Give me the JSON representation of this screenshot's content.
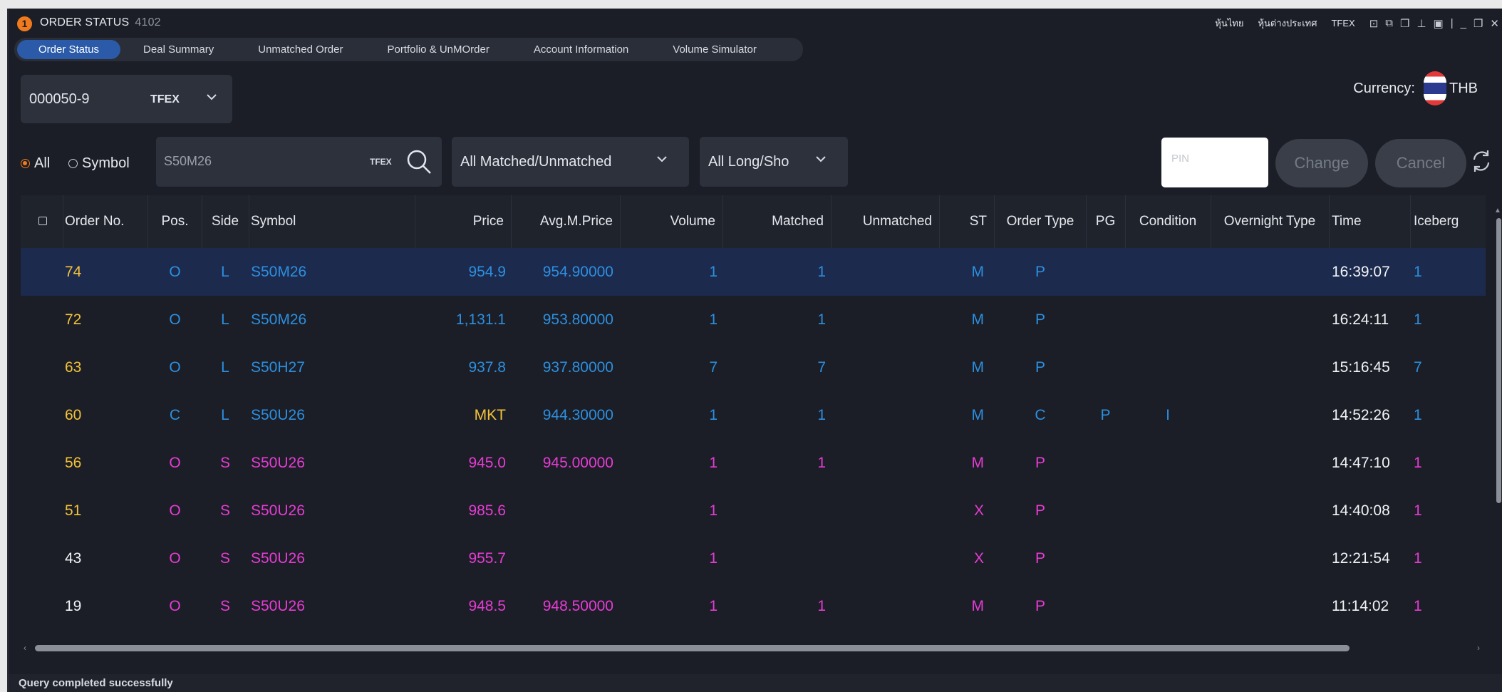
{
  "window": {
    "badge": "1",
    "title": "ORDER STATUS",
    "code": "4102",
    "links": [
      "หุ้นไทย",
      "หุ้นต่างประเทศ",
      "TFEX"
    ]
  },
  "tabs": [
    "Order Status",
    "Deal Summary",
    "Unmatched Order",
    "Portfolio & UnMOrder",
    "Account Information",
    "Volume Simulator"
  ],
  "account": {
    "id": "000050-9",
    "market": "TFEX"
  },
  "currency": {
    "label": "Currency:",
    "value": "THB"
  },
  "filter": {
    "radio_all": "All",
    "radio_symbol": "Symbol",
    "symbol_value": "S50M26",
    "symbol_market": "TFEX",
    "match_filter": "All Matched/Unmatched",
    "side_filter": "All Long/Sho",
    "pin_placeholder": "PIN",
    "change_label": "Change",
    "cancel_label": "Cancel"
  },
  "table": {
    "columns": [
      "Order No.",
      "Pos.",
      "Side",
      "Symbol",
      "Price",
      "Avg.M.Price",
      "Volume",
      "Matched",
      "Unmatched",
      "ST",
      "Order Type",
      "PG",
      "Condition",
      "Overnight Type",
      "Time",
      "Iceberg"
    ],
    "rows": [
      {
        "order_no": "74",
        "pos": "O",
        "side": "L",
        "symbol": "S50M26",
        "price": "954.9",
        "avg_price": "954.90000",
        "volume": "1",
        "matched": "1",
        "unmatched": "",
        "st": "M",
        "order_type": "P",
        "pg": "",
        "condition": "",
        "overnight": "",
        "time": "16:39:07",
        "iceberg": "1"
      },
      {
        "order_no": "72",
        "pos": "O",
        "side": "L",
        "symbol": "S50M26",
        "price": "1,131.1",
        "avg_price": "953.80000",
        "volume": "1",
        "matched": "1",
        "unmatched": "",
        "st": "M",
        "order_type": "P",
        "pg": "",
        "condition": "",
        "overnight": "",
        "time": "16:24:11",
        "iceberg": "1"
      },
      {
        "order_no": "63",
        "pos": "O",
        "side": "L",
        "symbol": "S50H27",
        "price": "937.8",
        "avg_price": "937.80000",
        "volume": "7",
        "matched": "7",
        "unmatched": "",
        "st": "M",
        "order_type": "P",
        "pg": "",
        "condition": "",
        "overnight": "",
        "time": "15:16:45",
        "iceberg": "7"
      },
      {
        "order_no": "60",
        "pos": "C",
        "side": "L",
        "symbol": "S50U26",
        "price": "MKT",
        "avg_price": "944.30000",
        "volume": "1",
        "matched": "1",
        "unmatched": "",
        "st": "M",
        "order_type": "C",
        "pg": "P",
        "condition": "I",
        "overnight": "",
        "time": "14:52:26",
        "iceberg": "1"
      },
      {
        "order_no": "56",
        "pos": "O",
        "side": "S",
        "symbol": "S50U26",
        "price": "945.0",
        "avg_price": "945.00000",
        "volume": "1",
        "matched": "1",
        "unmatched": "",
        "st": "M",
        "order_type": "P",
        "pg": "",
        "condition": "",
        "overnight": "",
        "time": "14:47:10",
        "iceberg": "1"
      },
      {
        "order_no": "51",
        "pos": "O",
        "side": "S",
        "symbol": "S50U26",
        "price": "985.6",
        "avg_price": "",
        "volume": "1",
        "matched": "",
        "unmatched": "",
        "st": "X",
        "order_type": "P",
        "pg": "",
        "condition": "",
        "overnight": "",
        "time": "14:40:08",
        "iceberg": "1"
      },
      {
        "order_no": "43",
        "pos": "O",
        "side": "S",
        "symbol": "S50U26",
        "price": "955.7",
        "avg_price": "",
        "volume": "1",
        "matched": "",
        "unmatched": "",
        "st": "X",
        "order_type": "P",
        "pg": "",
        "condition": "",
        "overnight": "",
        "time": "12:21:54",
        "iceberg": "1"
      },
      {
        "order_no": "19",
        "pos": "O",
        "side": "S",
        "symbol": "S50U26",
        "price": "948.5",
        "avg_price": "948.50000",
        "volume": "1",
        "matched": "1",
        "unmatched": "",
        "st": "M",
        "order_type": "P",
        "pg": "",
        "condition": "",
        "overnight": "",
        "time": "11:14:02",
        "iceberg": "1"
      }
    ]
  },
  "status_bar": "Query completed successfully",
  "colors": {
    "long": "#2d8fe0",
    "short": "#e83bd6",
    "order_no_gold": "#f3c23a",
    "order_no_white": "#f2f3f6",
    "accent": "#f07a1d"
  },
  "icons": {
    "search": "search-icon",
    "refresh": "refresh-icon",
    "dropdown": "chevron-down-icon"
  }
}
